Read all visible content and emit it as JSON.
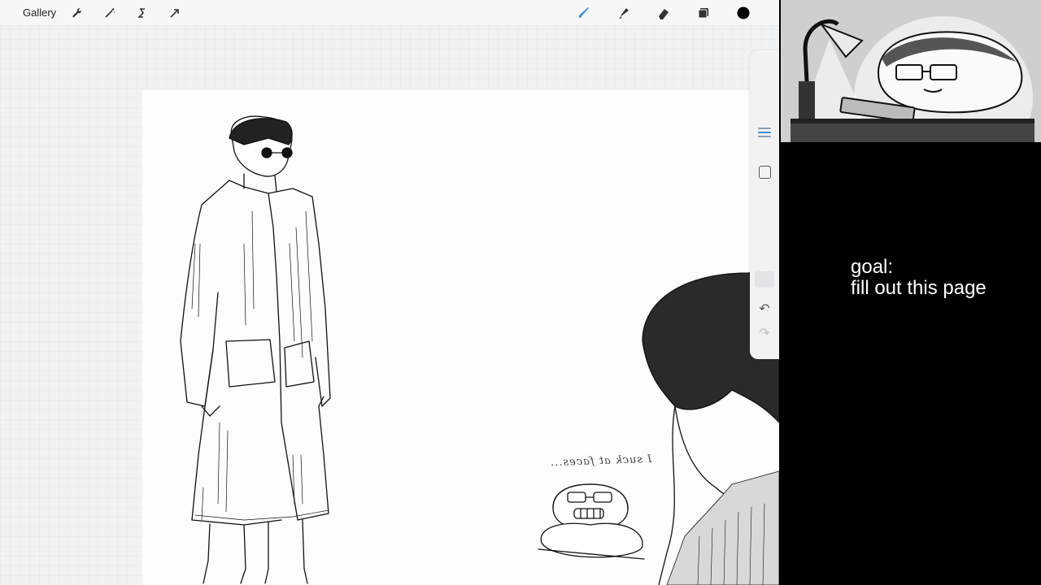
{
  "toolbar": {
    "gallery_label": "Gallery",
    "left_tools": [
      {
        "name": "actions",
        "icon": "wrench-icon"
      },
      {
        "name": "adjustments",
        "icon": "magic-wand-icon"
      },
      {
        "name": "selection",
        "icon": "selection-s-icon"
      },
      {
        "name": "transform",
        "icon": "arrow-cursor-icon"
      }
    ],
    "right_tools": [
      {
        "name": "brush",
        "icon": "brush-icon",
        "active": true
      },
      {
        "name": "smudge",
        "icon": "smudge-icon"
      },
      {
        "name": "eraser",
        "icon": "eraser-icon"
      },
      {
        "name": "layers",
        "icon": "layers-icon"
      },
      {
        "name": "color",
        "icon": "color-swatch",
        "color": "#000000"
      }
    ],
    "active_color": "#3b8fd8"
  },
  "sidebar": {
    "controls": [
      "brush-size-slider",
      "modify-button",
      "opacity-slider",
      "undo-button",
      "redo-button"
    ]
  },
  "canvas": {
    "handwritten_note": "I suck at faces..."
  },
  "overlay": {
    "goal_label": "goal:",
    "goal_text": "fill out this page"
  }
}
